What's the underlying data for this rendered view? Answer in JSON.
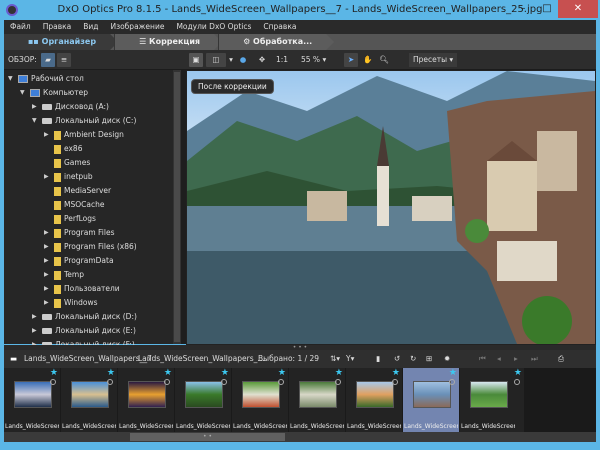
{
  "window": {
    "title": "DxO Optics Pro 8.1.5 - Lands_WideScreen_Wallpapers__7 - Lands_WideScreen_Wallpapers_25.jpg",
    "minimize": "–",
    "maximize": "□",
    "close": "✕"
  },
  "menu": [
    "Файл",
    "Правка",
    "Вид",
    "Изображение",
    "Модули DxO Optics",
    "Справка"
  ],
  "tabs": [
    {
      "label": "Органайзер",
      "icon": "grid-icon"
    },
    {
      "label": "Коррекция",
      "icon": "sliders-icon"
    },
    {
      "label": "Обработка...",
      "icon": "gears-icon"
    }
  ],
  "toolbar": {
    "overview_label": "ОБЗОР:",
    "zoom_1to1": "1:1",
    "zoom_level": "55 %",
    "presets": "Пресеты",
    "tooltip": "После коррекции"
  },
  "tree": [
    {
      "label": "Рабочий стол",
      "level": 0,
      "expanded": true,
      "icon": "desktop"
    },
    {
      "label": "Компьютер",
      "level": 1,
      "expanded": true,
      "icon": "pc"
    },
    {
      "label": "Дисковод (A:)",
      "level": 2,
      "expandable": true,
      "icon": "drive"
    },
    {
      "label": "Локальный диск (C:)",
      "level": 2,
      "expanded": true,
      "icon": "drive"
    },
    {
      "label": "Ambient Design",
      "level": 3,
      "expandable": true,
      "icon": "folder"
    },
    {
      "label": "ex86",
      "level": 3,
      "icon": "folder"
    },
    {
      "label": "Games",
      "level": 3,
      "icon": "folder"
    },
    {
      "label": "inetpub",
      "level": 3,
      "expandable": true,
      "icon": "folder"
    },
    {
      "label": "MediaServer",
      "level": 3,
      "icon": "folder"
    },
    {
      "label": "MSOCache",
      "level": 3,
      "icon": "folder"
    },
    {
      "label": "PerfLogs",
      "level": 3,
      "icon": "folder"
    },
    {
      "label": "Program Files",
      "level": 3,
      "expandable": true,
      "icon": "folder"
    },
    {
      "label": "Program Files (x86)",
      "level": 3,
      "expandable": true,
      "icon": "folder"
    },
    {
      "label": "ProgramData",
      "level": 3,
      "expandable": true,
      "icon": "folder"
    },
    {
      "label": "Temp",
      "level": 3,
      "expandable": true,
      "icon": "folder"
    },
    {
      "label": "Пользователи",
      "level": 3,
      "expandable": true,
      "icon": "folder"
    },
    {
      "label": "Windows",
      "level": 3,
      "expandable": true,
      "icon": "folder"
    },
    {
      "label": "Локальный диск (D:)",
      "level": 2,
      "expandable": true,
      "icon": "drive"
    },
    {
      "label": "Локальный диск (E:)",
      "level": 2,
      "expandable": true,
      "icon": "drive"
    },
    {
      "label": "Локальный диск (F:)",
      "level": 2,
      "expandable": true,
      "icon": "drive"
    }
  ],
  "filmstrip": {
    "folder": "Lands_WideScreen_Wallpapers__7",
    "project": "Lands_WideScreen_Wallpapers_...",
    "selected": "Выбрано: 1 / 29",
    "thumbs": [
      {
        "name": "Lands_WideScreen_Wal",
        "colors": [
          "#3a6fb8",
          "#c9c9d8",
          "#20304a"
        ]
      },
      {
        "name": "Lands_WideScreen_Wal",
        "colors": [
          "#4a90d8",
          "#d8c090",
          "#2a5a8a"
        ]
      },
      {
        "name": "Lands_WideScreen_Wal",
        "colors": [
          "#2a1a40",
          "#e8a030",
          "#302050"
        ]
      },
      {
        "name": "Lands_WideScreen_Wal",
        "colors": [
          "#8ac0e8",
          "#3a7a2a",
          "#2a4a20"
        ]
      },
      {
        "name": "Lands_WideScreen_Wal",
        "colors": [
          "#5a9a3a",
          "#e0e0d0",
          "#c05030"
        ]
      },
      {
        "name": "Lands_WideScreen_Wal",
        "colors": [
          "#4a7a3a",
          "#d8d8c8",
          "#7a8a6a"
        ]
      },
      {
        "name": "Lands_WideScreen_Wal",
        "colors": [
          "#a8c8e8",
          "#e0a060",
          "#3a6a2a"
        ]
      },
      {
        "name": "Lands_WideScreen_Wal",
        "colors": [
          "#a0c0e0",
          "#6a90b8",
          "#8a6a5a"
        ],
        "selected": true
      },
      {
        "name": "Lands_WideScreen_Wal",
        "colors": [
          "#d8e8f0",
          "#4a8a3a",
          "#6aaa4a"
        ]
      }
    ]
  },
  "colors": {
    "accent": "#3cc8f0",
    "frame": "#5bb6e6",
    "active_tab_text": "#8cc8f0"
  }
}
